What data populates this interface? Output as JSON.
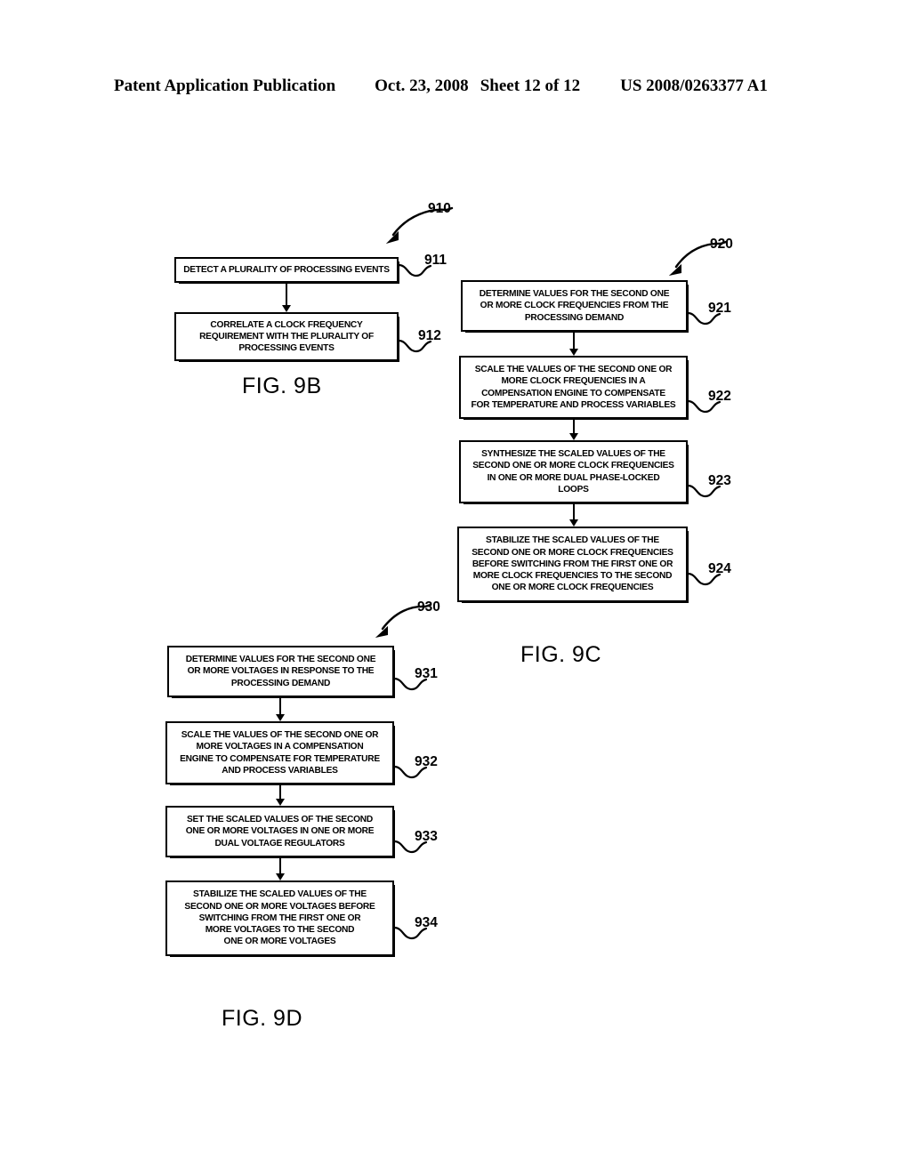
{
  "header": {
    "publication": "Patent Application Publication",
    "date": "Oct. 23, 2008",
    "sheet": "Sheet 12 of 12",
    "patent_number": "US 2008/0263377 A1"
  },
  "figures": [
    {
      "id": "fig-9b",
      "caption": "FIG. 9B",
      "flow_ref": "910",
      "steps": [
        {
          "ref": "911",
          "lines": [
            "DETECT A PLURALITY OF PROCESSING EVENTS"
          ]
        },
        {
          "ref": "912",
          "lines": [
            "CORRELATE A CLOCK FREQUENCY",
            "REQUIREMENT WITH THE PLURALITY OF",
            "PROCESSING EVENTS"
          ]
        }
      ]
    },
    {
      "id": "fig-9c",
      "caption": "FIG. 9C",
      "flow_ref": "920",
      "steps": [
        {
          "ref": "921",
          "lines": [
            "DETERMINE VALUES FOR THE SECOND ONE",
            "OR MORE CLOCK FREQUENCIES FROM THE",
            "PROCESSING DEMAND"
          ]
        },
        {
          "ref": "922",
          "lines": [
            "SCALE THE VALUES OF THE SECOND ONE OR",
            "MORE CLOCK FREQUENCIES IN A",
            "COMPENSATION ENGINE TO COMPENSATE",
            "FOR TEMPERATURE AND PROCESS VARIABLES"
          ]
        },
        {
          "ref": "923",
          "lines": [
            "SYNTHESIZE THE SCALED VALUES OF THE",
            "SECOND ONE OR MORE CLOCK FREQUENCIES",
            "IN ONE OR MORE DUAL PHASE-LOCKED",
            "LOOPS"
          ]
        },
        {
          "ref": "924",
          "lines": [
            "STABILIZE THE SCALED VALUES OF THE",
            "SECOND ONE OR MORE CLOCK FREQUENCIES",
            "BEFORE SWITCHING FROM THE FIRST ONE OR",
            "MORE CLOCK FREQUENCIES TO THE SECOND",
            "ONE OR MORE CLOCK FREQUENCIES"
          ]
        }
      ]
    },
    {
      "id": "fig-9d",
      "caption": "FIG. 9D",
      "flow_ref": "930",
      "steps": [
        {
          "ref": "931",
          "lines": [
            "DETERMINE VALUES FOR THE SECOND ONE",
            "OR MORE VOLTAGES IN RESPONSE TO THE",
            "PROCESSING DEMAND"
          ]
        },
        {
          "ref": "932",
          "lines": [
            "SCALE THE VALUES OF THE SECOND ONE OR",
            "MORE VOLTAGES IN A COMPENSATION",
            "ENGINE TO COMPENSATE FOR TEMPERATURE",
            "AND PROCESS VARIABLES"
          ]
        },
        {
          "ref": "933",
          "lines": [
            "SET THE SCALED VALUES OF THE SECOND",
            "ONE OR MORE VOLTAGES IN ONE OR MORE",
            "DUAL VOLTAGE REGULATORS"
          ]
        },
        {
          "ref": "934",
          "lines": [
            "STABILIZE THE SCALED VALUES OF THE",
            "SECOND ONE OR MORE VOLTAGES BEFORE",
            "SWITCHING FROM THE FIRST ONE OR",
            "MORE VOLTAGES TO THE SECOND",
            "ONE OR MORE VOLTAGES"
          ]
        }
      ]
    }
  ]
}
